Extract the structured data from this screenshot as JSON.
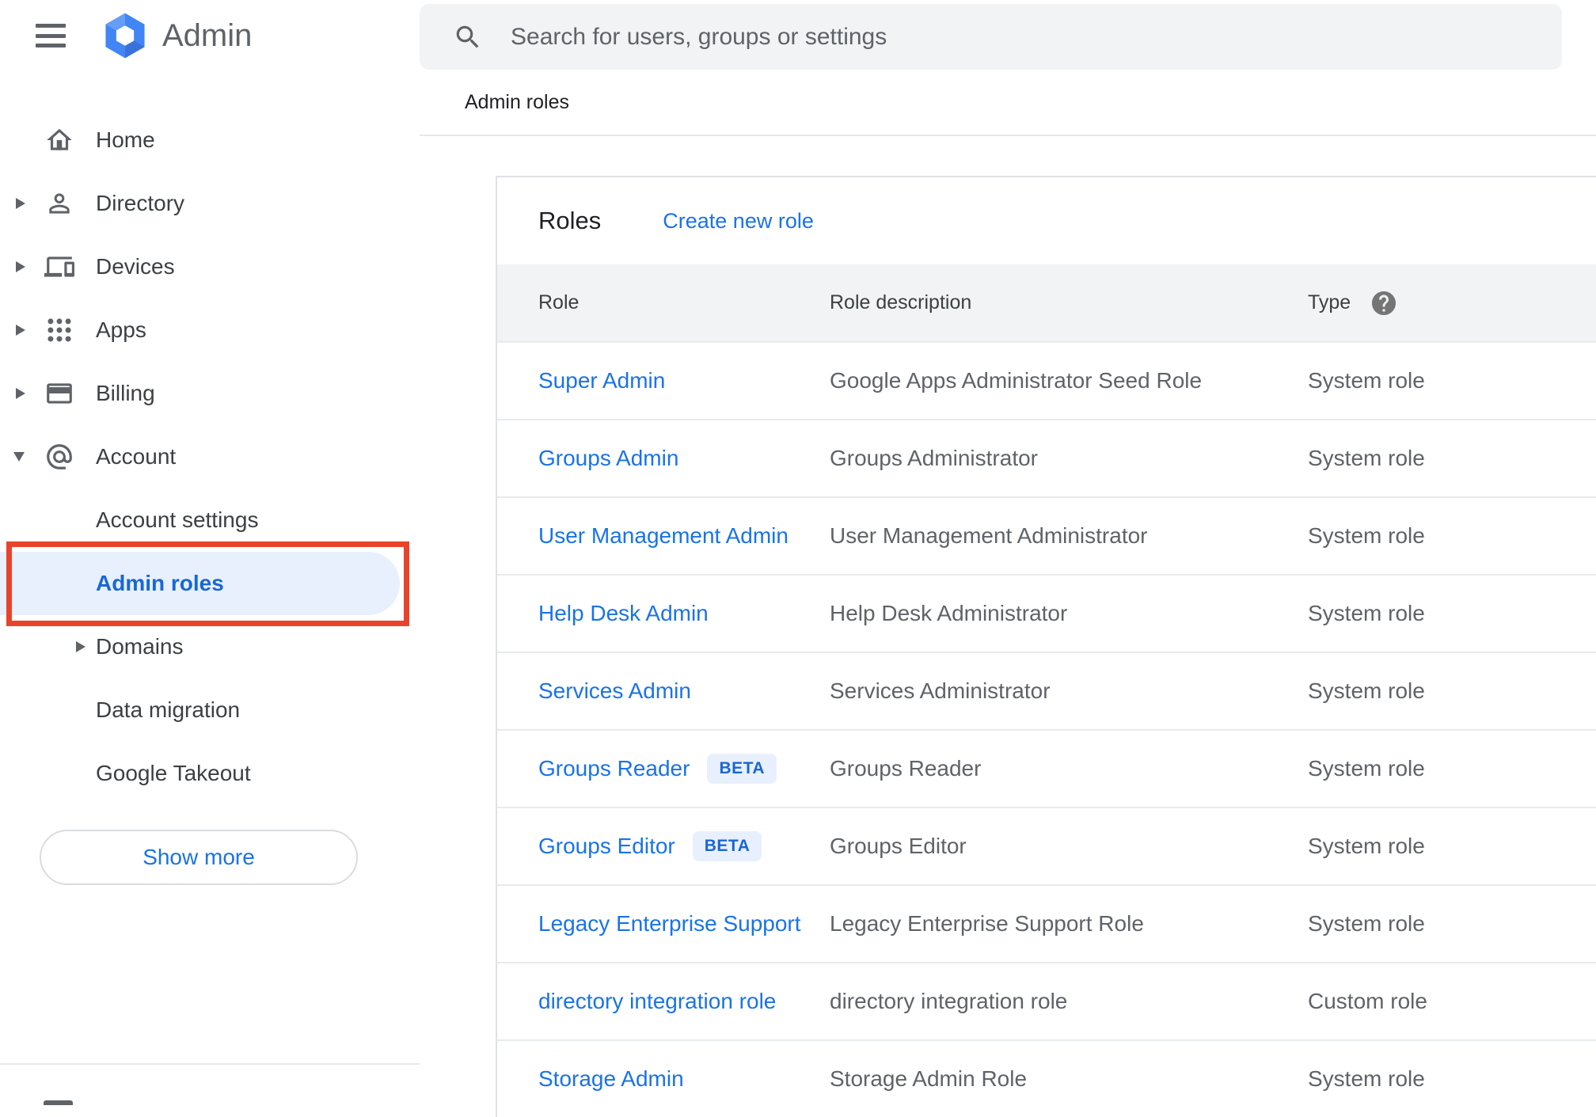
{
  "app": {
    "logo_icon": "admin-hexagon-icon",
    "name": "Admin"
  },
  "search": {
    "icon": "search-icon",
    "placeholder": "Search for users, groups or settings"
  },
  "breadcrumb": "Admin roles",
  "sidebar": {
    "items": [
      {
        "label": "Home",
        "icon": "home-icon",
        "arrow": "none",
        "level": 1
      },
      {
        "label": "Directory",
        "icon": "person-icon",
        "arrow": "right",
        "level": 1
      },
      {
        "label": "Devices",
        "icon": "devices-icon",
        "arrow": "right",
        "level": 1
      },
      {
        "label": "Apps",
        "icon": "apps-icon",
        "arrow": "right",
        "level": 1
      },
      {
        "label": "Billing",
        "icon": "card-icon",
        "arrow": "right",
        "level": 1
      },
      {
        "label": "Account",
        "icon": "at-icon",
        "arrow": "down",
        "level": 1,
        "expanded": true
      },
      {
        "label": "Account settings",
        "icon": "none",
        "arrow": "none",
        "level": 2
      },
      {
        "label": "Admin roles",
        "icon": "none",
        "arrow": "none",
        "level": 2,
        "selected": true,
        "annotated": "red-box"
      },
      {
        "label": "Domains",
        "icon": "none",
        "arrow": "right",
        "level": 2
      },
      {
        "label": "Data migration",
        "icon": "none",
        "arrow": "none",
        "level": 2
      },
      {
        "label": "Google Takeout",
        "icon": "none",
        "arrow": "none",
        "level": 2
      }
    ],
    "show_more_label": "Show more"
  },
  "main": {
    "title": "Roles",
    "create_link": "Create new role",
    "table": {
      "columns": {
        "role": "Role",
        "description": "Role description",
        "type": "Type"
      },
      "type_help_icon": "help-icon",
      "beta_badge": "BETA",
      "rows": [
        {
          "role": "Super Admin",
          "beta": false,
          "description": "Google Apps Administrator Seed Role",
          "type": "System role"
        },
        {
          "role": "Groups Admin",
          "beta": false,
          "description": "Groups Administrator",
          "type": "System role"
        },
        {
          "role": "User Management Admin",
          "beta": false,
          "description": "User Management Administrator",
          "type": "System role"
        },
        {
          "role": "Help Desk Admin",
          "beta": false,
          "description": "Help Desk Administrator",
          "type": "System role"
        },
        {
          "role": "Services Admin",
          "beta": false,
          "description": "Services Administrator",
          "type": "System role"
        },
        {
          "role": "Groups Reader",
          "beta": true,
          "description": "Groups Reader",
          "type": "System role"
        },
        {
          "role": "Groups Editor",
          "beta": true,
          "description": "Groups Editor",
          "type": "System role"
        },
        {
          "role": "Legacy Enterprise Support",
          "beta": false,
          "description": "Legacy Enterprise Support Role",
          "type": "System role"
        },
        {
          "role": "directory integration role",
          "beta": false,
          "description": "directory integration role",
          "type": "Custom role"
        },
        {
          "role": "Storage Admin",
          "beta": false,
          "description": "Storage Admin Role",
          "type": "System role"
        }
      ]
    }
  },
  "colors": {
    "link_blue": "#1a73e8",
    "selected_text_blue": "#1967d2",
    "selected_pill_bg": "#e8f0fe",
    "annotation_red": "#e9442b",
    "beta_bg": "#e8f0fe",
    "beta_text": "#1967d2",
    "icon_gray": "#5f6368",
    "text_dark": "#202124",
    "text_gray": "#5f6368",
    "header_row_bg": "#f1f3f4",
    "search_bg": "#f1f3f4",
    "divider": "#e8eaed",
    "logo_blue": "#4285f4"
  }
}
